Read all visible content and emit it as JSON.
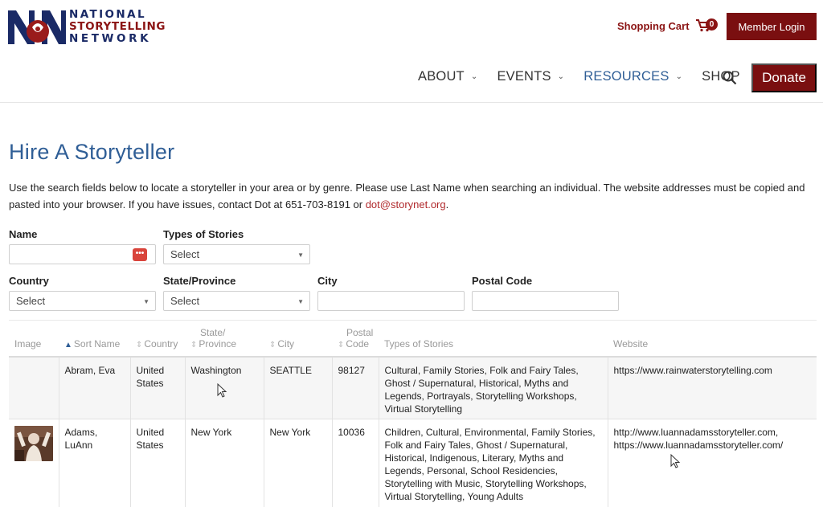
{
  "brand": {
    "line1": "NATIONAL",
    "line2": "STORYTELLING",
    "line3": "NETWORK",
    "colors": {
      "navy": "#1a2a66",
      "red": "#8b1414"
    }
  },
  "header": {
    "cart_label": "Shopping Cart",
    "cart_count": "0",
    "member_login": "Member Login"
  },
  "nav": {
    "items": [
      {
        "label": "ABOUT"
      },
      {
        "label": "EVENTS"
      },
      {
        "label": "RESOURCES"
      },
      {
        "label": "SHOP"
      }
    ],
    "donate": "Donate"
  },
  "page": {
    "title": "Hire A Storyteller",
    "intro": "Use the search fields below to locate a storyteller in your area or by genre. Please use Last Name when searching an individual. The website addresses must be copied and pasted into your browser. If you have issues, contact Dot at 651-703-8191 or ",
    "intro_email": "dot@storynet.org",
    "intro_end": "."
  },
  "filters": {
    "name_label": "Name",
    "name_value": "",
    "types_label": "Types of Stories",
    "types_value": "Select",
    "country_label": "Country",
    "country_value": "Select",
    "state_label": "State/Province",
    "state_value": "Select",
    "city_label": "City",
    "city_value": "",
    "postal_label": "Postal Code",
    "postal_value": ""
  },
  "table": {
    "headers": {
      "image": "Image",
      "sort_name": "Sort Name",
      "country": "Country",
      "state_l1": "State/",
      "state_l2": "Province",
      "city": "City",
      "postal_l1": "Postal",
      "postal_l2": "Code",
      "types": "Types of Stories",
      "website": "Website"
    },
    "rows": [
      {
        "name": "Abram, Eva",
        "country": "United States",
        "state": "Washington",
        "city": "SEATTLE",
        "postal": "98127",
        "types": "Cultural, Family Stories, Folk and Fairy Tales, Ghost / Supernatural, Historical, Myths and Legends, Portrayals, Storytelling Workshops, Virtual Storytelling",
        "website": "https://www.rainwaterstorytelling.com"
      },
      {
        "name": "Adams, LuAnn",
        "country": "United States",
        "state": "New York",
        "city": "New York",
        "postal": "10036",
        "types": "Children, Cultural, Environmental, Family Stories, Folk and Fairy Tales, Ghost / Supernatural, Historical, Indigenous, Literary, Myths and Legends, Personal, School Residencies, Storytelling with Music, Storytelling Workshops, Virtual Storytelling, Young Adults",
        "website": "http://www.luannadamsstoryteller.com, https://www.luannadamsstoryteller.com/"
      }
    ]
  },
  "colors": {
    "accent_blue": "#2f5e96",
    "button_red": "#7a0f10",
    "link_red": "#b0282b"
  }
}
